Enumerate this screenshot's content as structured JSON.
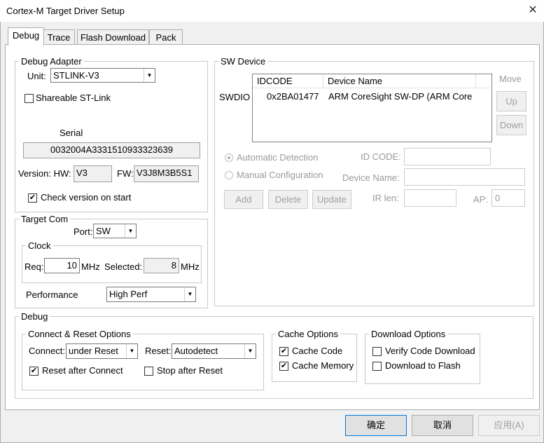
{
  "window": {
    "title": "Cortex-M Target Driver Setup"
  },
  "tabs": [
    {
      "label": "Debug"
    },
    {
      "label": "Trace"
    },
    {
      "label": "Flash Download"
    },
    {
      "label": "Pack"
    }
  ],
  "debug_adapter": {
    "group_label": "Debug Adapter",
    "unit_label": "Unit:",
    "unit_value": "STLINK-V3",
    "shareable_label": "Shareable ST-Link",
    "shareable_checked": false,
    "serial_label": "Serial",
    "serial_value": "0032004A3331510933323639",
    "version_label": "Version: HW:",
    "hw_value": "V3",
    "fw_label": "FW:",
    "fw_value": "V3J8M3B5S1",
    "check_version_label": "Check version on start",
    "check_version_checked": true
  },
  "target_com": {
    "group_label": "Target Com",
    "port_label": "Port:",
    "port_value": "SW",
    "clock_label": "Clock",
    "req_label": "Req:",
    "req_value": "10",
    "mhz1": "MHz",
    "selected_label": "Selected:",
    "selected_value": "8",
    "mhz2": "MHz",
    "performance_label": "Performance",
    "performance_value": "High Perf"
  },
  "sw_device": {
    "group_label": "SW Device",
    "move_label": "Move",
    "up_label": "Up",
    "down_label": "Down",
    "swdio_label": "SWDIO",
    "col_idcode": "IDCODE",
    "col_device_name": "Device Name",
    "row": {
      "idcode": "0x2BA01477",
      "device_name": "ARM CoreSight SW-DP (ARM Core"
    },
    "auto_detect_label": "Automatic Detection",
    "manual_config_label": "Manual Configuration",
    "id_code_label": "ID CODE:",
    "device_name_label": "Device Name:",
    "ir_len_label": "IR len:",
    "ap_label": "AP:",
    "ap_value": "0",
    "add_label": "Add",
    "delete_label": "Delete",
    "update_label": "Update"
  },
  "debug": {
    "group_label": "Debug",
    "connect_reset_label": "Connect & Reset Options",
    "connect_label": "Connect:",
    "connect_value": "under Reset",
    "reset_label": "Reset:",
    "reset_value": "Autodetect",
    "reset_after_connect_label": "Reset after Connect",
    "reset_after_connect_checked": true,
    "stop_after_reset_label": "Stop after Reset",
    "stop_after_reset_checked": false,
    "cache_options_label": "Cache Options",
    "cache_code_label": "Cache Code",
    "cache_code_checked": true,
    "cache_memory_label": "Cache Memory",
    "cache_memory_checked": true,
    "download_options_label": "Download Options",
    "verify_code_label": "Verify Code Download",
    "verify_code_checked": false,
    "download_flash_label": "Download to Flash",
    "download_flash_checked": false
  },
  "footer": {
    "ok_label": "确定",
    "cancel_label": "取消",
    "apply_label": "应用(A)"
  },
  "icons": {
    "close": "close-icon",
    "dropdown": "chevron-down-icon",
    "check": "checkmark-icon"
  }
}
